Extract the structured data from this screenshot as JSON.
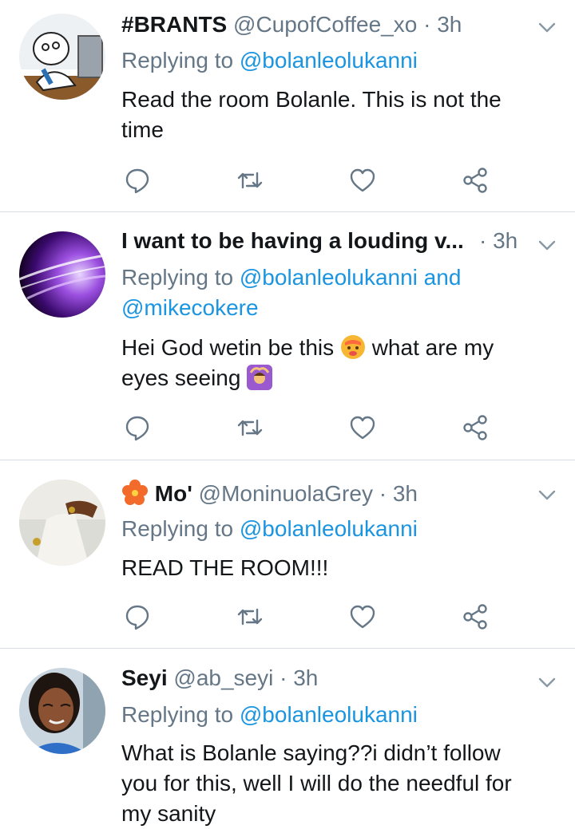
{
  "tweets": [
    {
      "name": "#BRANTS",
      "handle": "@CupofCoffee_xo",
      "sep": "·",
      "time": "3h",
      "reply_prefix": "Replying to",
      "reply_mention": "@bolanleolukanni",
      "reply_mention2": "",
      "body_line1": "Read the room Bolanle. This is not the",
      "body_line2": "time"
    },
    {
      "name": "I want to be having a louding v...",
      "handle": "",
      "sep": "·",
      "time": "3h",
      "reply_prefix": "Replying to",
      "reply_mention": "@bolanleolukanni and",
      "reply_mention2": "@mikecokere",
      "body_line1a": "Hei God wetin be this",
      "body_line1b": "what are my",
      "body_line2": "eyes seeing",
      "emoji1": "hot-face-emoji",
      "emoji2": "woman-gesturing-ok-emoji"
    },
    {
      "name": "Mo'",
      "handle": "@MoninuolaGrey",
      "sep": "·",
      "time": "3h",
      "reply_prefix": "Replying to",
      "reply_mention": "@bolanleolukanni",
      "body_line1": "READ THE ROOM!!!",
      "flower": "hibiscus-emoji"
    },
    {
      "name": "Seyi",
      "handle": "@ab_seyi",
      "sep": "·",
      "time": "3h",
      "reply_prefix": "Replying to",
      "reply_mention": "@bolanleolukanni",
      "body_line1": "What is Bolanle saying??i didn’t follow",
      "body_line2": "you for this, well I will do the needful for",
      "body_line3": "my sanity"
    }
  ],
  "icons": {
    "reply": "reply-icon",
    "retweet": "retweet-icon",
    "like": "heart-icon",
    "share": "share-icon",
    "more": "chevron-down-icon"
  },
  "colors": {
    "text": "#14171a",
    "secondary": "#657786",
    "link": "#1b95e0",
    "divider": "#d7dde2"
  }
}
